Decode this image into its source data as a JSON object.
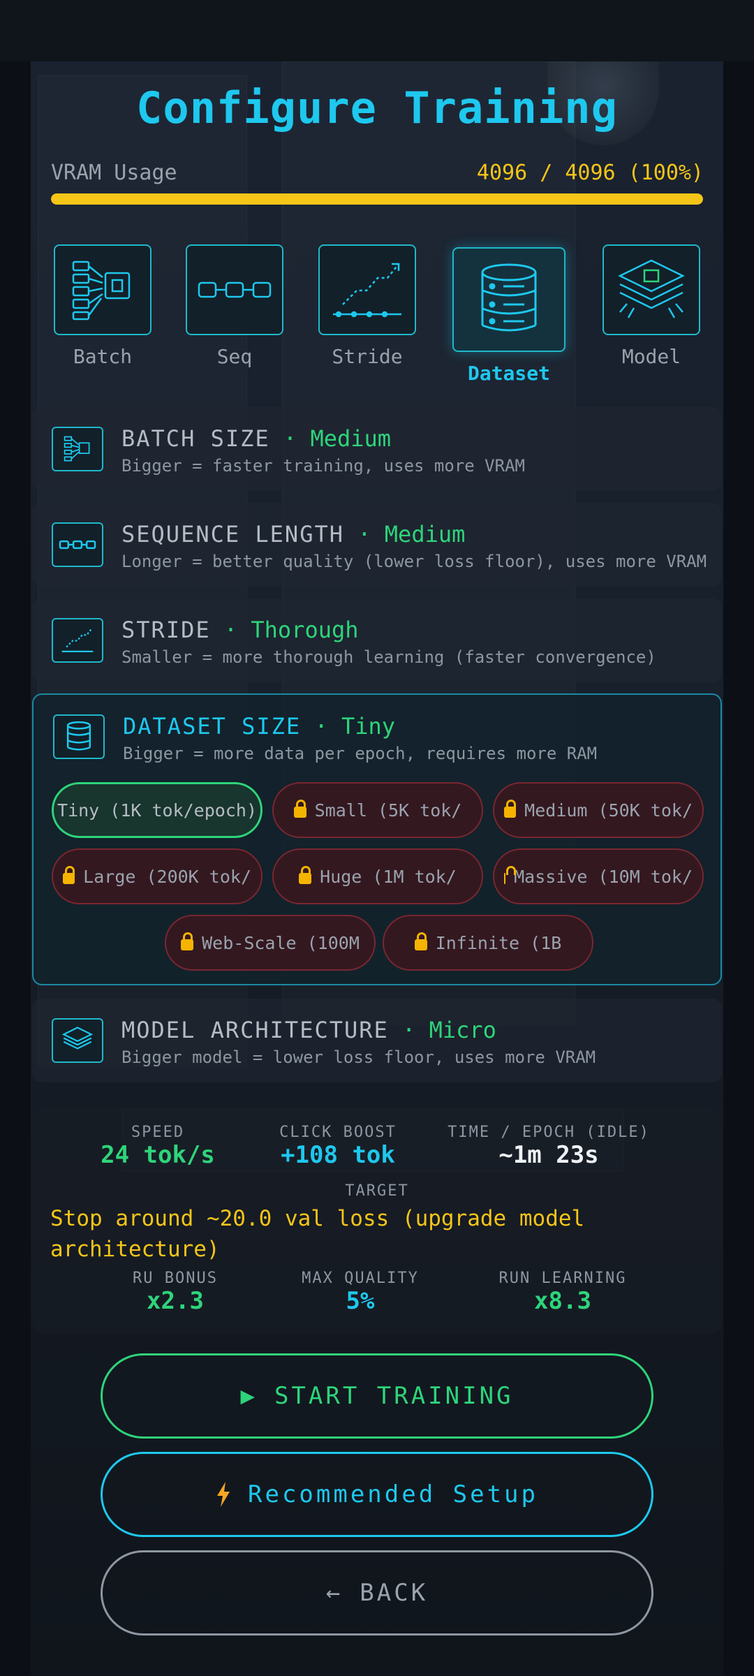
{
  "title": "Configure Training",
  "vram": {
    "label": "VRAM Usage",
    "value": "4096 / 4096 (100%)",
    "fraction": 1.0,
    "color": "#f5c518"
  },
  "tabs": [
    {
      "label": "Batch",
      "icon": "batch-chip-icon"
    },
    {
      "label": "Seq",
      "icon": "sequence-chain-icon"
    },
    {
      "label": "Stride",
      "icon": "stride-steps-icon"
    },
    {
      "label": "Dataset",
      "icon": "database-icon",
      "active": true
    },
    {
      "label": "Model",
      "icon": "model-layers-icon"
    }
  ],
  "sections": {
    "batch": {
      "title": "BATCH SIZE",
      "sep": " · ",
      "level": "Medium",
      "desc": "Bigger = faster training, uses more VRAM"
    },
    "seq": {
      "title": "SEQUENCE LENGTH",
      "sep": " · ",
      "level": "Medium",
      "desc": "Longer = better quality (lower loss floor), uses more VRAM"
    },
    "stride": {
      "title": "STRIDE",
      "sep": " · ",
      "level": "Thorough",
      "desc": "Smaller = more thorough learning (faster convergence)"
    },
    "dataset": {
      "title": "DATASET SIZE",
      "sep": " · ",
      "level": "Tiny",
      "desc": "Bigger = more data per epoch, requires more RAM",
      "options": [
        {
          "label": "Tiny (1K tok/epoch)",
          "selected": true,
          "locked": false
        },
        {
          "label": "Small (5K tok/",
          "locked": true
        },
        {
          "label": "Medium (50K tok/",
          "locked": true
        },
        {
          "label": "Large (200K tok/",
          "locked": true
        },
        {
          "label": "Huge (1M tok/",
          "locked": true
        },
        {
          "label": "Massive (10M tok/",
          "locked": true
        },
        {
          "label": "Web-Scale (100M",
          "locked": true
        },
        {
          "label": "Infinite (1B",
          "locked": true
        }
      ]
    },
    "model": {
      "title": "MODEL ARCHITECTURE",
      "sep": " · ",
      "level": "Micro",
      "desc": "Bigger model = lower loss floor, uses more VRAM"
    }
  },
  "stats": {
    "speed": {
      "label": "SPEED",
      "value": "24 tok/s"
    },
    "click_boost": {
      "label": "CLICK BOOST",
      "value": "+108 tok"
    },
    "time_epoch": {
      "label": "TIME / EPOCH (IDLE)",
      "value": "~1m 23s"
    },
    "target": {
      "label": "TARGET",
      "value": "Stop around ~20.0 val loss (upgrade model architecture)"
    },
    "ru_bonus": {
      "label": "RU BONUS",
      "value": "x2.3"
    },
    "max_quality": {
      "label": "MAX QUALITY",
      "value": "5%"
    },
    "run_learning": {
      "label": "RUN LEARNING",
      "value": "x8.3"
    }
  },
  "buttons": {
    "start": {
      "icon": "▶",
      "label": "START TRAINING"
    },
    "recommended": {
      "icon": "lightning-icon",
      "label": "Recommended Setup"
    },
    "back": {
      "icon": "←",
      "label": "BACK"
    }
  },
  "colors": {
    "cyan": "#1ec8ee",
    "green": "#2ed47a",
    "yellow": "#f5c518",
    "locked_border": "#7a2730"
  }
}
